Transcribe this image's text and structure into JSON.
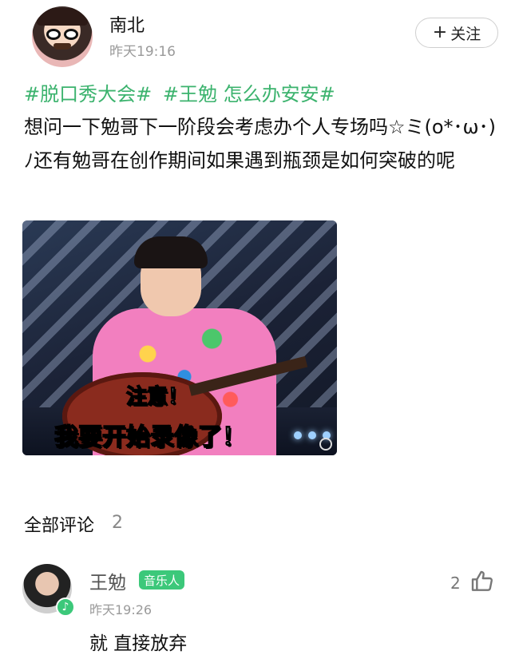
{
  "post": {
    "author": "南北",
    "time": "昨天19:16",
    "follow_label": "关注",
    "follow_icon": "plus-icon",
    "topics": [
      "#脱口秀大会#",
      "#王勉 怎么办安安#"
    ],
    "text": "想问一下勉哥下一阶段会考虑办个人专场吗☆ミ(o*･ω･)ﾉ还有勉哥在创作期间如果遇到瓶颈是如何突破的呢",
    "image": {
      "caption_line1": "注意！",
      "caption_line2": "我要开始录像了！"
    }
  },
  "comments_header": {
    "title": "全部评论",
    "count": "2"
  },
  "comments": [
    {
      "author": "王勉",
      "tag": "音乐人",
      "badge_icon": "music-note-icon",
      "time": "昨天19:26",
      "text": "就 直接放弃",
      "likes": "2",
      "like_icon": "thumbs-up-icon"
    }
  ],
  "colors": {
    "accent": "#3cb36e",
    "text": "#111111",
    "muted": "#9a9a9a"
  }
}
